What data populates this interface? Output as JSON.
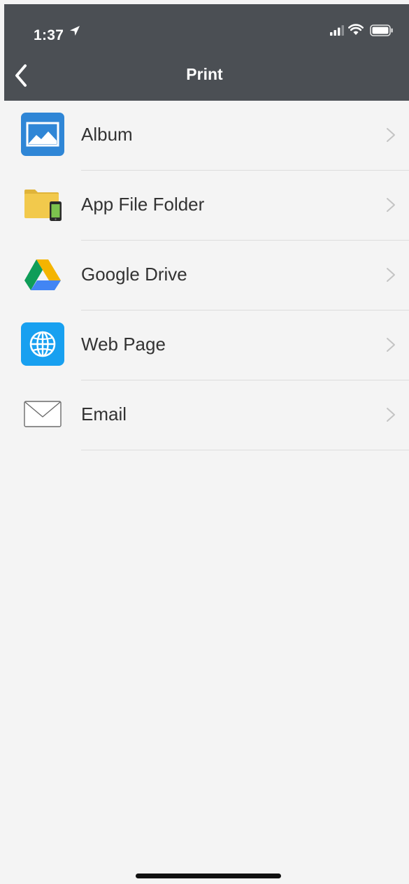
{
  "status_bar": {
    "time": "1:37",
    "icons": [
      "location-arrow-icon",
      "cellular-signal-icon",
      "wifi-icon",
      "battery-icon"
    ]
  },
  "nav_bar": {
    "title": "Print",
    "back_icon": "chevron-left-icon"
  },
  "list": {
    "items": [
      {
        "label": "Album",
        "icon": "album-photo-icon",
        "chevron": "chevron-right-icon"
      },
      {
        "label": "App File Folder",
        "icon": "app-file-folder-icon",
        "chevron": "chevron-right-icon"
      },
      {
        "label": "Google Drive",
        "icon": "google-drive-icon",
        "chevron": "chevron-right-icon"
      },
      {
        "label": "Web Page",
        "icon": "globe-icon",
        "chevron": "chevron-right-icon"
      },
      {
        "label": "Email",
        "icon": "envelope-icon",
        "chevron": "chevron-right-icon"
      }
    ]
  },
  "colors": {
    "header_background": "#4b4f54",
    "page_background": "#f4f4f4",
    "divider": "#dcdcdc",
    "chevron": "#c4c4c4",
    "album_blue": "#2f86d6",
    "web_page_blue": "#18a0f0",
    "folder_yellow": "#f2c94c"
  }
}
